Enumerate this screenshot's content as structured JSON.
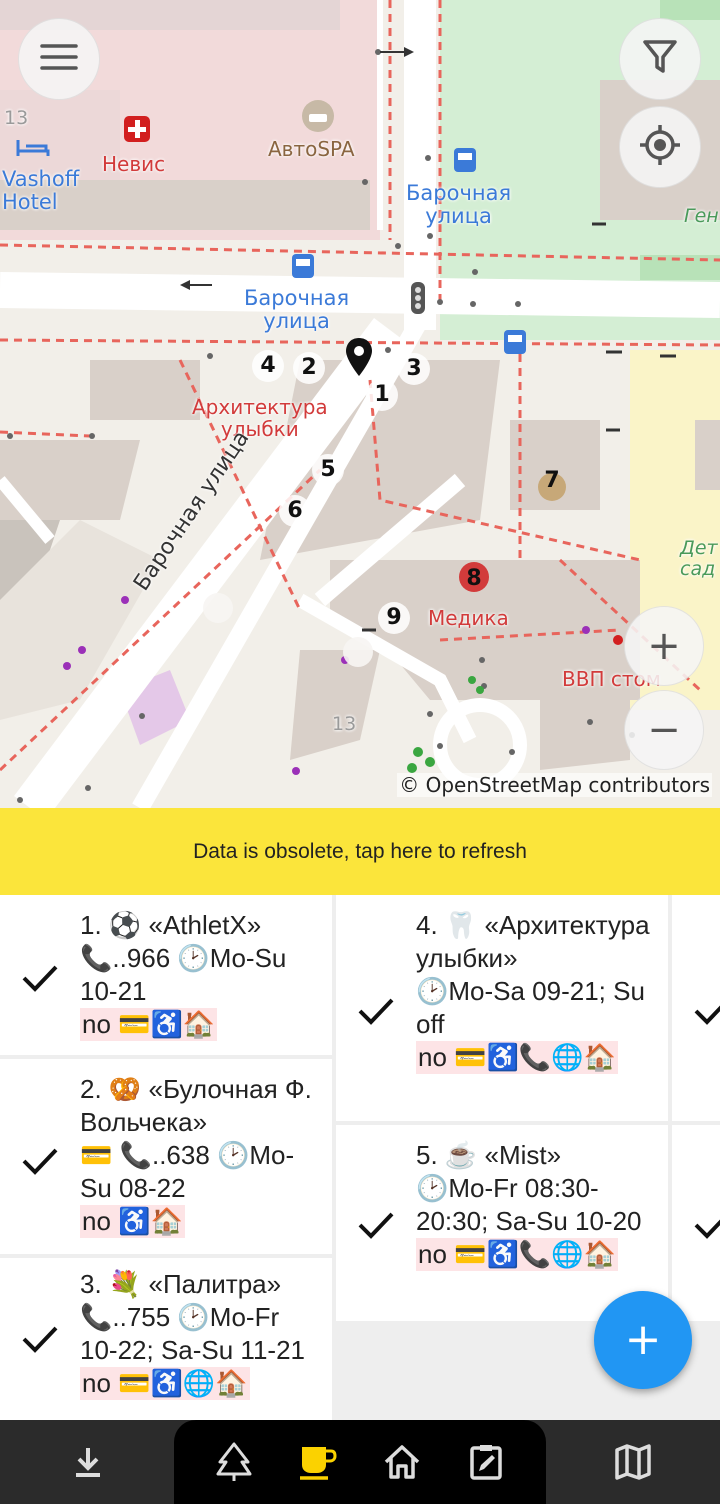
{
  "map": {
    "labels": {
      "street_top": "Барочная\nулица",
      "street_mid": "Барочная\nулица",
      "street_diag": "Барочная улица",
      "nevis": "Невис",
      "avtospa": "АвтоSPA",
      "vashoff": "Vashoff\nHotel",
      "house_13_top": "13",
      "house_13_bottom": "13",
      "arch": "Архитектура\nулыбки",
      "medika": "Медика",
      "vvp": "ВВП стом",
      "green_top": "Ген",
      "green_right": "Дет\nсад"
    },
    "poi_numbers": [
      "1",
      "2",
      "3",
      "4",
      "5",
      "6",
      "7",
      "8",
      "9"
    ],
    "attribution": "© OpenStreetMap contributors",
    "buttons": {
      "menu": "menu-icon",
      "filter": "filter-icon",
      "locate": "locate-icon",
      "zoom_in": "+",
      "zoom_out": "−"
    }
  },
  "banner": {
    "text": "Data is obsolete, tap here to refresh"
  },
  "places": [
    {
      "title": "1. ⚽ «AthletX»",
      "details": "📞..966 🕑Mo-Su 10-21",
      "tags": "no 💳♿🏠",
      "checked": true
    },
    {
      "title": "2. 🥨 «Булочная Ф. Вольчека»",
      "details": "💳 📞..638 🕑Mo-Su 08-22",
      "tags": "no ♿🏠",
      "checked": true
    },
    {
      "title": "3. 💐 «Палитра»",
      "details": "📞..755 🕑Mo-Fr 10-22; Sa-Su 11-21",
      "tags": "no 💳♿🌐🏠",
      "checked": true
    },
    {
      "title": "4. 🦷 «Архитектура улыбки»",
      "details": "🕑Mo-Sa 09-21; Su off",
      "tags": "no 💳♿📞🌐🏠",
      "checked": true
    },
    {
      "title": "5. ☕ «Mist»",
      "details": "🕑Mo-Fr 08:30-20:30; Sa-Su 10-20",
      "tags": "no 💳♿📞🌐🏠",
      "checked": true
    }
  ],
  "fab": {
    "label": "+"
  },
  "nav": {
    "items": [
      "download-icon",
      "tree-icon",
      "cup-icon",
      "home-icon",
      "edit-icon",
      "map-icon"
    ],
    "active": "cup-icon",
    "active_color": "#fbd200"
  },
  "colors": {
    "banner": "#fbe53b",
    "fab": "#2196f3",
    "nav_bg": "#2b2b2b"
  }
}
